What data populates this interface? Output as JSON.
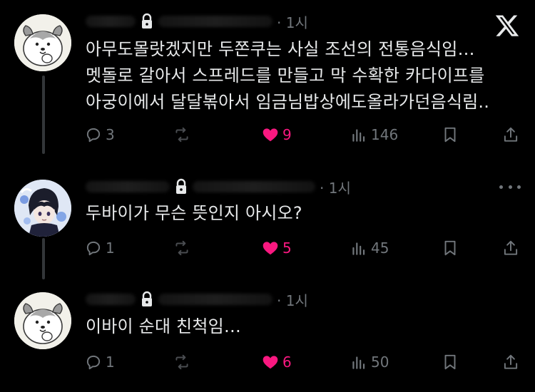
{
  "app": {
    "name": "X"
  },
  "colors": {
    "background": "#000000",
    "text": "#e7e9ea",
    "muted": "#71767b",
    "like": "#f91880",
    "thread_line": "#333639"
  },
  "posts": [
    {
      "id": "post-1",
      "author_avatar": "dog-avatar",
      "locked": true,
      "time": "· 1시",
      "lines": [
        "아무도몰랏겠지만 두쫀쿠는 사실 조선의 전통음식임…",
        "멧돌로 갈아서 스프레드를 만들고 막 수확한 카다이프를",
        "아궁이에서 달달볶아서 임금님밥상에도올라가던음식림.."
      ],
      "replies": "3",
      "reposts": "",
      "likes": "9",
      "liked": true,
      "views": "146"
    },
    {
      "id": "post-2",
      "author_avatar": "anime-avatar",
      "locked": true,
      "time": "· 1시",
      "lines": [
        "두바이가 무슨 뜻인지 아시오?"
      ],
      "replies": "1",
      "reposts": "",
      "likes": "5",
      "liked": true,
      "views": "45"
    },
    {
      "id": "post-3",
      "author_avatar": "dog-avatar",
      "locked": true,
      "time": "· 1시",
      "lines": [
        "이바이 순대 친척임…"
      ],
      "replies": "1",
      "reposts": "",
      "likes": "6",
      "liked": true,
      "views": "50"
    }
  ]
}
